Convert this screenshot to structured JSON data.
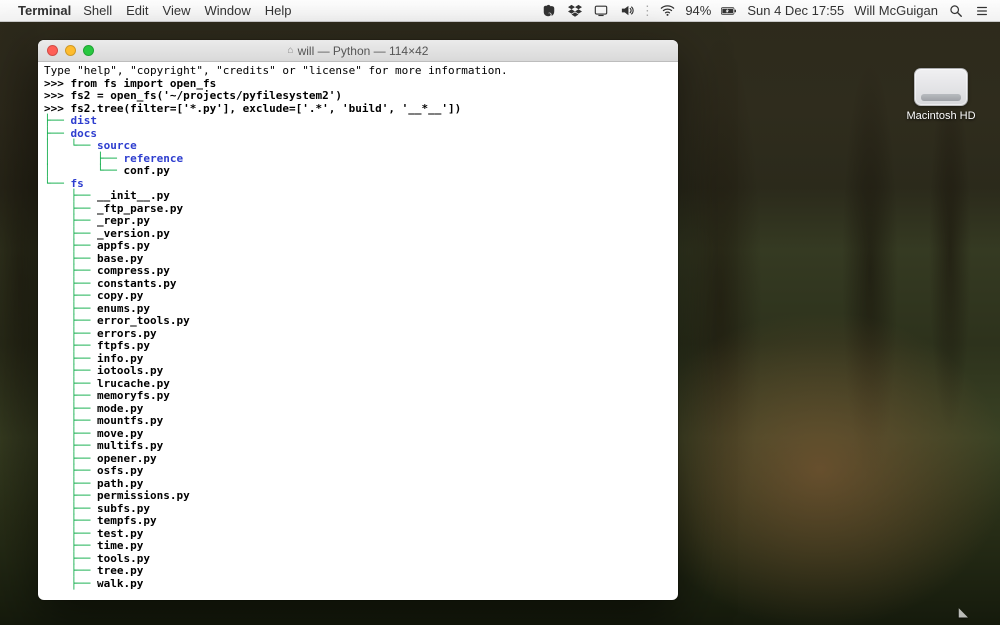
{
  "menubar": {
    "app_name": "Terminal",
    "items": [
      "Shell",
      "Edit",
      "View",
      "Window",
      "Help"
    ],
    "status": {
      "battery": "94%",
      "datetime": "Sun 4 Dec  17:55",
      "user": "Will McGuigan"
    }
  },
  "desktop": {
    "hd_label": "Macintosh HD"
  },
  "terminal": {
    "title": "will — Python — 114×42",
    "intro": "Type \"help\", \"copyright\", \"credits\" or \"license\" for more information.",
    "prompts": [
      ">>> from fs import open_fs",
      ">>> fs2 = open_fs('~/projects/pyfilesystem2')",
      ">>> fs2.tree(filter=['*.py'], exclude=['.*', 'build', '__*__'])"
    ],
    "tree": [
      {
        "prefix": "├── ",
        "name": "dist",
        "type": "dir"
      },
      {
        "prefix": "├── ",
        "name": "docs",
        "type": "dir"
      },
      {
        "prefix": "│   └── ",
        "name": "source",
        "type": "dir"
      },
      {
        "prefix": "│       ├── ",
        "name": "reference",
        "type": "dir"
      },
      {
        "prefix": "│       └── ",
        "name": "conf.py",
        "type": "file"
      },
      {
        "prefix": "└── ",
        "name": "fs",
        "type": "dir"
      },
      {
        "prefix": "    ├── ",
        "name": "__init__.py",
        "type": "file"
      },
      {
        "prefix": "    ├── ",
        "name": "_ftp_parse.py",
        "type": "file"
      },
      {
        "prefix": "    ├── ",
        "name": "_repr.py",
        "type": "file"
      },
      {
        "prefix": "    ├── ",
        "name": "_version.py",
        "type": "file"
      },
      {
        "prefix": "    ├── ",
        "name": "appfs.py",
        "type": "file"
      },
      {
        "prefix": "    ├── ",
        "name": "base.py",
        "type": "file"
      },
      {
        "prefix": "    ├── ",
        "name": "compress.py",
        "type": "file"
      },
      {
        "prefix": "    ├── ",
        "name": "constants.py",
        "type": "file"
      },
      {
        "prefix": "    ├── ",
        "name": "copy.py",
        "type": "file"
      },
      {
        "prefix": "    ├── ",
        "name": "enums.py",
        "type": "file"
      },
      {
        "prefix": "    ├── ",
        "name": "error_tools.py",
        "type": "file"
      },
      {
        "prefix": "    ├── ",
        "name": "errors.py",
        "type": "file"
      },
      {
        "prefix": "    ├── ",
        "name": "ftpfs.py",
        "type": "file"
      },
      {
        "prefix": "    ├── ",
        "name": "info.py",
        "type": "file"
      },
      {
        "prefix": "    ├── ",
        "name": "iotools.py",
        "type": "file"
      },
      {
        "prefix": "    ├── ",
        "name": "lrucache.py",
        "type": "file"
      },
      {
        "prefix": "    ├── ",
        "name": "memoryfs.py",
        "type": "file"
      },
      {
        "prefix": "    ├── ",
        "name": "mode.py",
        "type": "file"
      },
      {
        "prefix": "    ├── ",
        "name": "mountfs.py",
        "type": "file"
      },
      {
        "prefix": "    ├── ",
        "name": "move.py",
        "type": "file"
      },
      {
        "prefix": "    ├── ",
        "name": "multifs.py",
        "type": "file"
      },
      {
        "prefix": "    ├── ",
        "name": "opener.py",
        "type": "file"
      },
      {
        "prefix": "    ├── ",
        "name": "osfs.py",
        "type": "file"
      },
      {
        "prefix": "    ├── ",
        "name": "path.py",
        "type": "file"
      },
      {
        "prefix": "    ├── ",
        "name": "permissions.py",
        "type": "file"
      },
      {
        "prefix": "    ├── ",
        "name": "subfs.py",
        "type": "file"
      },
      {
        "prefix": "    ├── ",
        "name": "tempfs.py",
        "type": "file"
      },
      {
        "prefix": "    ├── ",
        "name": "test.py",
        "type": "file"
      },
      {
        "prefix": "    ├── ",
        "name": "time.py",
        "type": "file"
      },
      {
        "prefix": "    ├── ",
        "name": "tools.py",
        "type": "file"
      },
      {
        "prefix": "    ├── ",
        "name": "tree.py",
        "type": "file"
      },
      {
        "prefix": "    ├── ",
        "name": "walk.py",
        "type": "file"
      }
    ]
  }
}
